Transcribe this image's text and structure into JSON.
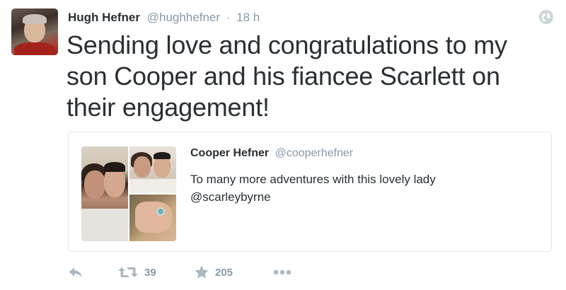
{
  "tweet": {
    "author": {
      "display_name": "Hugh Hefner",
      "handle": "@hughhefner",
      "separator": "·",
      "time": "18 h"
    },
    "text": "Sending love and congratulations to my son Cooper and his fiancee Scarlett on their engagement!",
    "quoted_tweet": {
      "display_name": "Cooper Hefner",
      "handle": "@cooperhefner",
      "text_line1": "To many more adventures with this lovely lady",
      "text_line2": "@scarleybyrne"
    },
    "actions": {
      "reply_icon": "reply-arrow-icon",
      "retweet_icon": "retweet-arrows-icon",
      "retweet_count": "39",
      "favorite_icon": "star-icon",
      "favorite_count": "205",
      "more_icon": "more-dots-icon"
    },
    "globe_icon": "globe-icon"
  },
  "colors": {
    "text": "#292f33",
    "muted": "#8899a6",
    "border": "#e1e8ed",
    "icon_light": "#ccd6dd"
  }
}
